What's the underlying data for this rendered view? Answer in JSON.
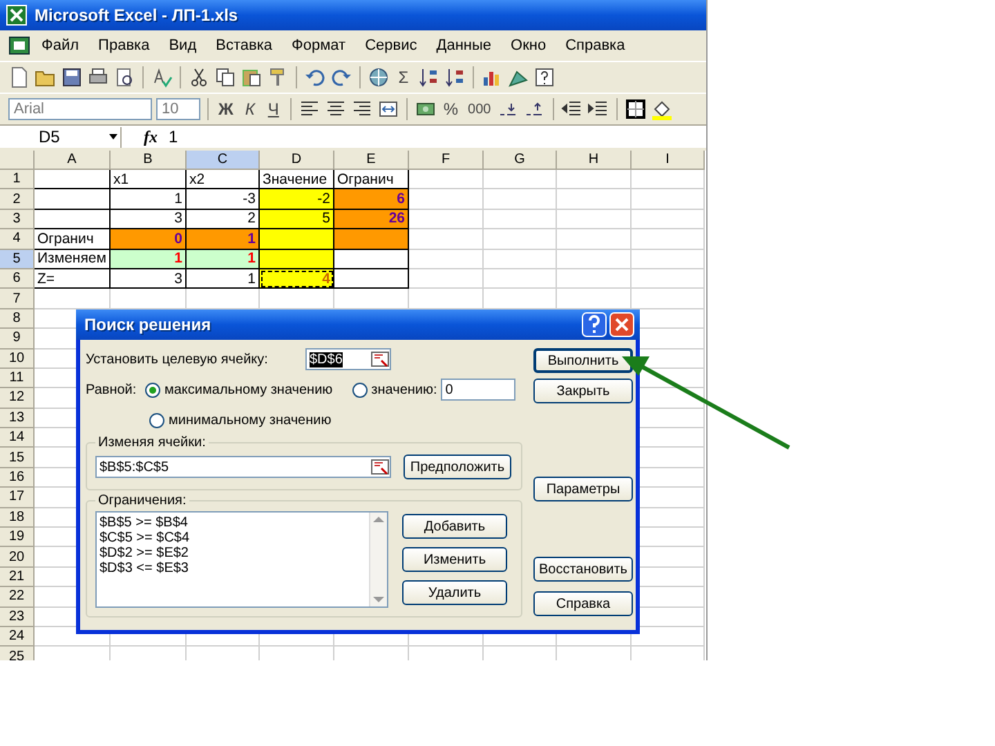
{
  "window": {
    "title": "Microsoft Excel - ЛП-1.xls"
  },
  "menu": [
    "Файл",
    "Правка",
    "Вид",
    "Вставка",
    "Формат",
    "Сервис",
    "Данные",
    "Окно",
    "Справка"
  ],
  "standard_toolbar": {
    "sum": "Σ"
  },
  "format_toolbar": {
    "font": "Arial",
    "size": "10",
    "bold": "Ж",
    "italic": "К",
    "underline": "Ч",
    "percent": "%",
    "thousands": "000"
  },
  "formula_bar": {
    "name_box": "D5",
    "function_sign": "fx",
    "value": "1"
  },
  "sheet": {
    "columns": [
      {
        "label": "A",
        "selected": false
      },
      {
        "label": "B",
        "selected": false
      },
      {
        "label": "C",
        "selected": true
      },
      {
        "label": "D",
        "selected": false
      },
      {
        "label": "E",
        "selected": false
      },
      {
        "label": "F",
        "selected": false
      },
      {
        "label": "G",
        "selected": false
      },
      {
        "label": "H",
        "selected": false
      },
      {
        "label": "I",
        "selected": false
      }
    ],
    "rows": [
      {
        "label": "1",
        "selected": false,
        "cells": [
          {
            "border": true
          },
          {
            "text": "x1",
            "border": true
          },
          {
            "text": "x2",
            "border": true
          },
          {
            "text": "Значение",
            "border": true
          },
          {
            "text": "Огранич",
            "border": true
          }
        ]
      },
      {
        "label": "2",
        "selected": false,
        "cells": [
          {
            "border": true
          },
          {
            "text": "1",
            "numeric": true,
            "border": true
          },
          {
            "text": "-3",
            "numeric": true,
            "border": true
          },
          {
            "text": "-2",
            "numeric": true,
            "color": "#ffff00",
            "border": true
          },
          {
            "text": "6",
            "numeric": true,
            "color": "#ff9900",
            "bold": true,
            "border": true
          }
        ]
      },
      {
        "label": "3",
        "selected": false,
        "cells": [
          {
            "border": true
          },
          {
            "text": "3",
            "numeric": true,
            "border": true
          },
          {
            "text": "2",
            "numeric": true,
            "border": true
          },
          {
            "text": "5",
            "numeric": true,
            "color": "#ffff00",
            "border": true
          },
          {
            "text": "26",
            "numeric": true,
            "color": "#ff9900",
            "bold": true,
            "border": true
          }
        ]
      },
      {
        "label": "4",
        "selected": false,
        "cells": [
          {
            "text": "Огранич",
            "border": true
          },
          {
            "text": "0",
            "numeric": true,
            "color": "#ff9900",
            "bold": true,
            "border": true
          },
          {
            "text": "1",
            "numeric": true,
            "color": "#ff9900",
            "bold": true,
            "border": true
          },
          {
            "color": "#ffff00",
            "border": true
          },
          {
            "color": "#ff9900",
            "border": true
          }
        ]
      },
      {
        "label": "5",
        "selected": true,
        "cells": [
          {
            "text": "Изменяем",
            "border": true
          },
          {
            "text": "1",
            "numeric": true,
            "color": "#ccffcc",
            "bold": true,
            "border": true
          },
          {
            "text": "1",
            "numeric": true,
            "color": "#ccffcc",
            "bold": true,
            "border": true
          },
          {
            "color": "#ffff00",
            "border": true
          },
          {
            "border": true
          }
        ]
      },
      {
        "label": "6",
        "selected": false,
        "cells": [
          {
            "text": "Z=",
            "border": true
          },
          {
            "text": "3",
            "numeric": true,
            "border": true
          },
          {
            "text": "1",
            "numeric": true,
            "border": true
          },
          {
            "text": "4",
            "numeric": true,
            "color": "#ffff00",
            "bold": true,
            "marquee": true,
            "border": true
          },
          {
            "border": true
          }
        ]
      },
      {
        "label": "7",
        "selected": false
      },
      {
        "label": "8",
        "selected": false
      },
      {
        "label": "9",
        "selected": false
      },
      {
        "label": "10",
        "selected": false
      },
      {
        "label": "11",
        "selected": false
      },
      {
        "label": "12",
        "selected": false
      },
      {
        "label": "13",
        "selected": false
      },
      {
        "label": "14",
        "selected": false
      },
      {
        "label": "15",
        "selected": false
      },
      {
        "label": "16",
        "selected": false
      },
      {
        "label": "17",
        "selected": false
      },
      {
        "label": "18",
        "selected": false
      },
      {
        "label": "19",
        "selected": false
      },
      {
        "label": "20",
        "selected": false
      },
      {
        "label": "21",
        "selected": false
      },
      {
        "label": "22",
        "selected": false
      },
      {
        "label": "23",
        "selected": false
      },
      {
        "label": "24",
        "selected": false
      },
      {
        "label": "25",
        "selected": false
      }
    ]
  },
  "solver_dialog": {
    "title": "Поиск решения",
    "target_label": "Установить целевую ячейку:",
    "target_value": "$D$6",
    "equal_label": "Равной:",
    "options": [
      {
        "label": "максимальному значению",
        "selected": true
      },
      {
        "label": "значению:",
        "selected": false
      },
      {
        "label": "минимальному значению",
        "selected": false
      }
    ],
    "value_field": "0",
    "changing_label": "Изменяя ячейки:",
    "changing_value": "$B$5:$C$5",
    "guess_button": "Предположить",
    "constraints_label": "Ограничения:",
    "constraints": [
      "$B$5 >= $B$4",
      "$C$5 >= $C$4",
      "$D$2 >= $E$2",
      "$D$3 <= $E$3"
    ],
    "constraint_buttons": [
      "Добавить",
      "Изменить",
      "Удалить"
    ],
    "side_buttons": [
      "Выполнить",
      "Закрыть",
      "Параметры",
      "Восстановить",
      "Справка"
    ]
  }
}
